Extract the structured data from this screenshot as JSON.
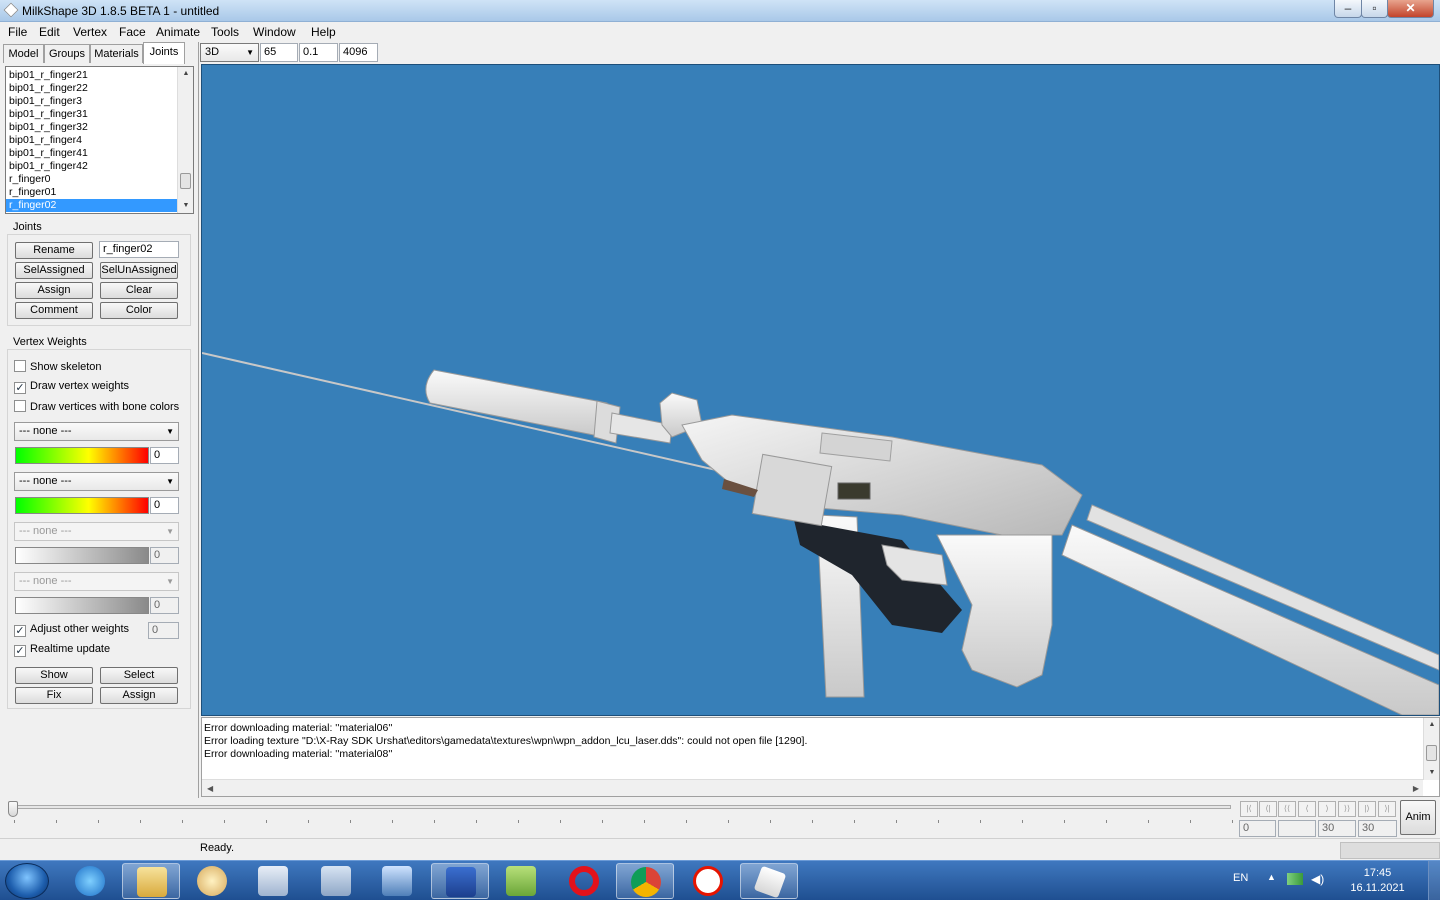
{
  "window": {
    "title": "MilkShape 3D 1.8.5 BETA 1 - untitled",
    "minimize_label": "–",
    "maximize_label": "▫",
    "close_label": "✕"
  },
  "menu": [
    "File",
    "Edit",
    "Vertex",
    "Face",
    "Animate",
    "Tools",
    "Window",
    "Help"
  ],
  "tabs": [
    "Model",
    "Groups",
    "Materials",
    "Joints"
  ],
  "active_tab": "Joints",
  "joints_list": [
    "bip01_r_finger21",
    "bip01_r_finger22",
    "bip01_r_finger3",
    "bip01_r_finger31",
    "bip01_r_finger32",
    "bip01_r_finger4",
    "bip01_r_finger41",
    "bip01_r_finger42",
    "r_finger0",
    "r_finger01",
    "r_finger02"
  ],
  "selected_joint": "r_finger02",
  "joints_panel": {
    "group_label": "Joints",
    "rename_label": "Rename",
    "rename_value": "r_finger02",
    "sel_assigned_label": "SelAssigned",
    "sel_unassigned_label": "SelUnAssigned",
    "assign_label": "Assign",
    "clear_label": "Clear",
    "comment_label": "Comment",
    "color_label": "Color"
  },
  "vertex_weights": {
    "group_label": "Vertex Weights",
    "show_skeleton": {
      "label": "Show skeleton",
      "checked": false
    },
    "draw_vertex_weights": {
      "label": "Draw vertex weights",
      "checked": true
    },
    "draw_vertices_bone_colors": {
      "label": "Draw vertices with bone colors",
      "checked": false
    },
    "bone1": {
      "value": "--- none ---",
      "weight": "0"
    },
    "bone2": {
      "value": "--- none ---",
      "weight": "0"
    },
    "bone3": {
      "value": "--- none ---",
      "weight": "0"
    },
    "bone4": {
      "value": "--- none ---",
      "weight": "0"
    },
    "adjust_other_weights": {
      "label": "Adjust other weights",
      "checked": true,
      "value": "0"
    },
    "realtime_update": {
      "label": "Realtime update",
      "checked": true
    },
    "show_label": "Show",
    "select_label": "Select",
    "fix_label": "Fix",
    "assign_label": "Assign"
  },
  "viewport_toolbar": {
    "view_mode": "3D",
    "fov": "65",
    "near": "0.1",
    "far": "4096"
  },
  "log": [
    "Error downloading material: ''material06''",
    "Error loading texture \"D:\\X-Ray SDK Urshat\\editors\\gamedata\\textures\\wpn\\wpn_addon_lcu_laser.dds\": could not open file [1290].",
    "Error downloading material: ''material08''"
  ],
  "timeline": {
    "frame": "0",
    "blank": "",
    "frames_a": "30",
    "frames_b": "30",
    "anim_label": "Anim",
    "play_buttons": [
      "|⟨",
      "⟨|",
      "⟨⟨",
      "⟨",
      "⟩",
      "⟩⟩",
      "|⟩",
      "⟩|"
    ]
  },
  "status": "Ready.",
  "taskbar": {
    "apps": [
      "windows-explorer",
      "paint",
      "snipping-tool",
      "calculator",
      "remote-desktop",
      "save-disk",
      "notepad-plus",
      "opera",
      "chrome",
      "yandex-browser",
      "milkshape"
    ],
    "tray_lang": "EN",
    "time": "17:45",
    "date": "16.11.2021"
  },
  "colors": {
    "viewport_bg": "#377fb8",
    "selection": "#3399ff",
    "titlebar": "#b9d3ee"
  }
}
